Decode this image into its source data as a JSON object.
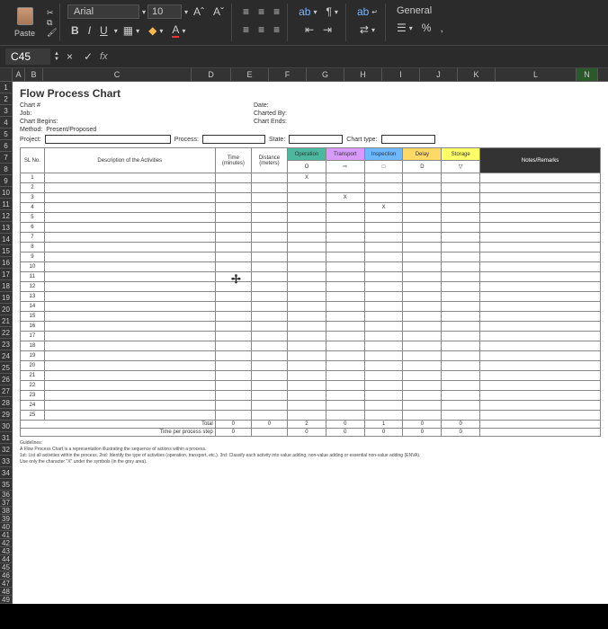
{
  "ribbon": {
    "paste_label": "Paste",
    "font_name": "Arial",
    "font_size": "10",
    "AA_grow": "Aˆ",
    "AA_shrink": "Aˇ",
    "bold": "B",
    "italic": "I",
    "underline": "U",
    "wrap": "ab",
    "number_format": "General",
    "percent": "%",
    "comma": ","
  },
  "namebox": {
    "cell": "C45",
    "fx": "fx",
    "cancel": "×",
    "confirm": "✓"
  },
  "columns": [
    "A",
    "B",
    "C",
    "D",
    "E",
    "F",
    "G",
    "H",
    "I",
    "J",
    "K",
    "L",
    "N"
  ],
  "sheet": {
    "title": "Flow Process Chart",
    "fields": {
      "chart_no": "Chart #",
      "date": "Date:",
      "job": "Job:",
      "charted_by": "Charted By:",
      "chart_begins": "Chart Begins:",
      "chart_ends": "Chart Ends:",
      "method": "Method:",
      "method_val": "Present/Proposed",
      "project": "Project:",
      "process": "Process:",
      "state": "State:",
      "chart_type": "Chart type:"
    },
    "headers": {
      "sl": "SL No.",
      "desc": "Description of the Activities",
      "time": "Time",
      "time_u": "(minutes)",
      "dist": "Distance",
      "dist_u": "(meters)",
      "op": "Operation",
      "tr": "Transport",
      "in": "Inspection",
      "de": "Delay",
      "st": "Storage",
      "rm": "Notes/Remarks"
    },
    "symbols": {
      "op": "O",
      "tr": "⇨",
      "in": "□",
      "de": "D",
      "st": "▽"
    },
    "rows": [
      {
        "n": "1",
        "op": "X"
      },
      {
        "n": "2"
      },
      {
        "n": "3",
        "tr": "X"
      },
      {
        "n": "4",
        "in": "X"
      },
      {
        "n": "5"
      },
      {
        "n": "6"
      },
      {
        "n": "7"
      },
      {
        "n": "8"
      },
      {
        "n": "9"
      },
      {
        "n": "10"
      },
      {
        "n": "11"
      },
      {
        "n": "12"
      },
      {
        "n": "13"
      },
      {
        "n": "14"
      },
      {
        "n": "15"
      },
      {
        "n": "16"
      },
      {
        "n": "17"
      },
      {
        "n": "18"
      },
      {
        "n": "19"
      },
      {
        "n": "20"
      },
      {
        "n": "21"
      },
      {
        "n": "22"
      },
      {
        "n": "23"
      },
      {
        "n": "24"
      },
      {
        "n": "25"
      }
    ],
    "totals": {
      "total_lbl": "Total",
      "tps_lbl": "Time per process step",
      "total": [
        "0",
        "0",
        "2",
        "0",
        "1",
        "0",
        "0"
      ],
      "tps": [
        "0",
        "",
        "0",
        "0",
        "0",
        "0",
        "0"
      ]
    },
    "guidelines": {
      "h": "Guidelines:",
      "l1": "A Flow Process Chart is a representation illustrating the sequence of actions within a process.",
      "l2": "1st: List all activities within the process. 2nd: Identify the type of activities (operation, transport, etc.). 3rd: Classify each activity into value adding, non-value adding or essential non-value adding (ENVA).",
      "l3": "Use only the character \"X\" under the symbols (in the grey area)."
    }
  }
}
